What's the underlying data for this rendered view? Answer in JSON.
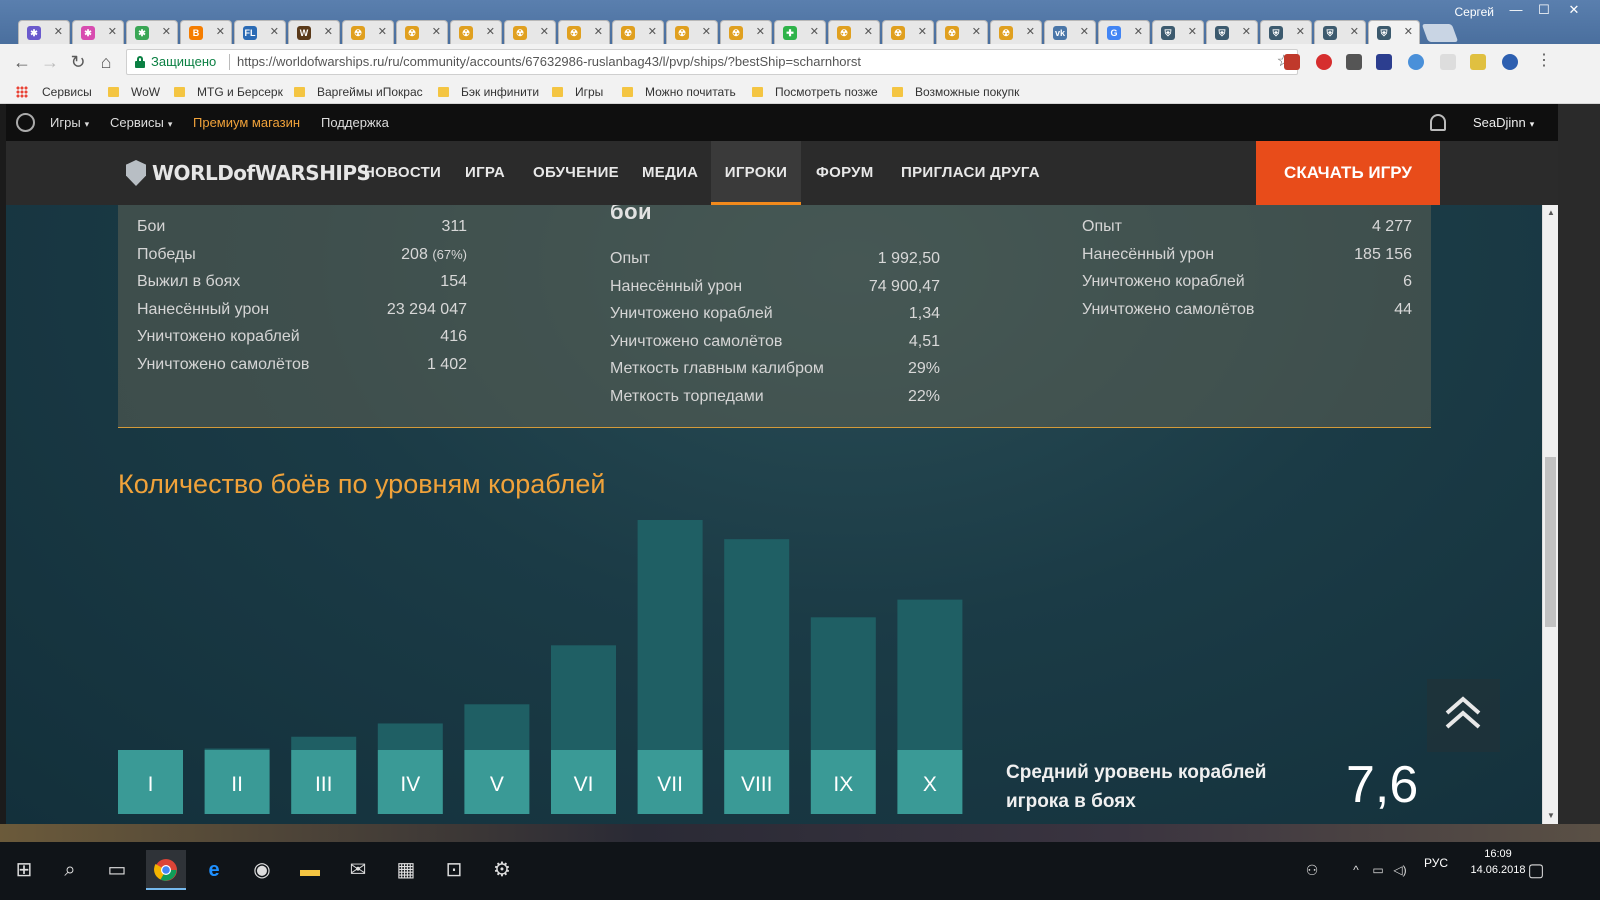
{
  "browser": {
    "profile": "Сергей",
    "window_controls": [
      "—",
      "☐",
      "✕"
    ],
    "tab_icons": [
      {
        "color": "#6a5acd",
        "glyph": "✱"
      },
      {
        "color": "#d84cb0",
        "glyph": "✱"
      },
      {
        "color": "#3aa655",
        "glyph": "✱"
      },
      {
        "color": "#f57d00",
        "glyph": "B"
      },
      {
        "color": "#2b6bb5",
        "glyph": "FL"
      },
      {
        "color": "#5a3a1a",
        "glyph": "W"
      },
      {
        "color": "#e0a020",
        "glyph": "☢"
      },
      {
        "color": "#e0a020",
        "glyph": "☢"
      },
      {
        "color": "#e0a020",
        "glyph": "☢"
      },
      {
        "color": "#e0a020",
        "glyph": "☢"
      },
      {
        "color": "#e0a020",
        "glyph": "☢"
      },
      {
        "color": "#e0a020",
        "glyph": "☢"
      },
      {
        "color": "#e0a020",
        "glyph": "☢"
      },
      {
        "color": "#e0a020",
        "glyph": "☢"
      },
      {
        "color": "#2fb34a",
        "glyph": "✚"
      },
      {
        "color": "#e0a020",
        "glyph": "☢"
      },
      {
        "color": "#e0a020",
        "glyph": "☢"
      },
      {
        "color": "#e0a020",
        "glyph": "☢"
      },
      {
        "color": "#e0a020",
        "glyph": "☢"
      },
      {
        "color": "#4a76a8",
        "glyph": "vk"
      },
      {
        "color": "#4285f4",
        "glyph": "G"
      },
      {
        "color": "#3c5a6e",
        "glyph": "⛨"
      },
      {
        "color": "#3c5a6e",
        "glyph": "⛨"
      },
      {
        "color": "#3c5a6e",
        "glyph": "⛨"
      },
      {
        "color": "#3c5a6e",
        "glyph": "⛨"
      },
      {
        "color": "#3c5a6e",
        "glyph": "⛨"
      }
    ],
    "secure_label": "Защищено",
    "url": "https://worldofwarships.ru/ru/community/accounts/67632986-ruslanbag43/l/pvp/ships/?bestShip=scharnhorst",
    "bookmarks": [
      "Сервисы",
      "WoW",
      "MTG и Берсерк",
      "Варгеймы иПокрас",
      "Бэк инфинити",
      "Игры",
      "Можно почитать",
      "Посмотреть позже",
      "Возможные покупк"
    ]
  },
  "site": {
    "topbar": {
      "items": [
        "Игры",
        "Сервисы",
        "Премиум магазин",
        "Поддержка"
      ],
      "user": "SeaDjinn",
      "accent": "#f0a23a"
    },
    "logo_text": "WORLDofWARSHIPS",
    "nav": [
      "НОВОСТИ",
      "ИГРА",
      "ОБУЧЕНИЕ",
      "МЕДИА",
      "ИГРОКИ",
      "ФОРУМ",
      "ПРИГЛАСИ ДРУГА"
    ],
    "active_nav": "ИГРОКИ",
    "download_label": "СКАЧАТЬ ИГРУ",
    "download_color": "#e84c1a"
  },
  "stats": {
    "col1": [
      {
        "label": "Бои",
        "value": "311"
      },
      {
        "label": "Победы",
        "value": "208",
        "extra": "(67%)"
      },
      {
        "label": "Выжил в боях",
        "value": "154"
      },
      {
        "label": "Нанесённый урон",
        "value": "23 294 047"
      },
      {
        "label": "Уничтожено кораблей",
        "value": "416"
      },
      {
        "label": "Уничтожено самолётов",
        "value": "1 402"
      }
    ],
    "col2_heading": "бои",
    "col2": [
      {
        "label": "Опыт",
        "value": "1 992,50"
      },
      {
        "label": "Нанесённый урон",
        "value": "74 900,47"
      },
      {
        "label": "Уничтожено кораблей",
        "value": "1,34"
      },
      {
        "label": "Уничтожено самолётов",
        "value": "4,51"
      },
      {
        "label": "Меткость главным калибром",
        "value": "29%"
      },
      {
        "label": "Меткость торпедами",
        "value": "22%"
      }
    ],
    "col3": [
      {
        "label": "Опыт",
        "value": "4 277"
      },
      {
        "label": "Нанесённый урон",
        "value": "185 156"
      },
      {
        "label": "Уничтожено кораблей",
        "value": "6"
      },
      {
        "label": "Уничтожено самолётов",
        "value": "44"
      }
    ]
  },
  "chart_data": {
    "type": "bar",
    "title": "Количество боёв по уровням кораблей",
    "categories": [
      "I",
      "II",
      "III",
      "IV",
      "V",
      "VI",
      "VII",
      "VIII",
      "IX",
      "X"
    ],
    "values": [
      0,
      1,
      9,
      18,
      31,
      71,
      156,
      143,
      90,
      102
    ],
    "bar_color": "#1f5f64",
    "label_box_color": "#3a9a96"
  },
  "average": {
    "label": "Средний уровень кораблей игрока в боях",
    "value": "7,6"
  },
  "taskbar": {
    "tray_lang": "РУС",
    "time": "16:09",
    "date": "14.06.2018"
  }
}
